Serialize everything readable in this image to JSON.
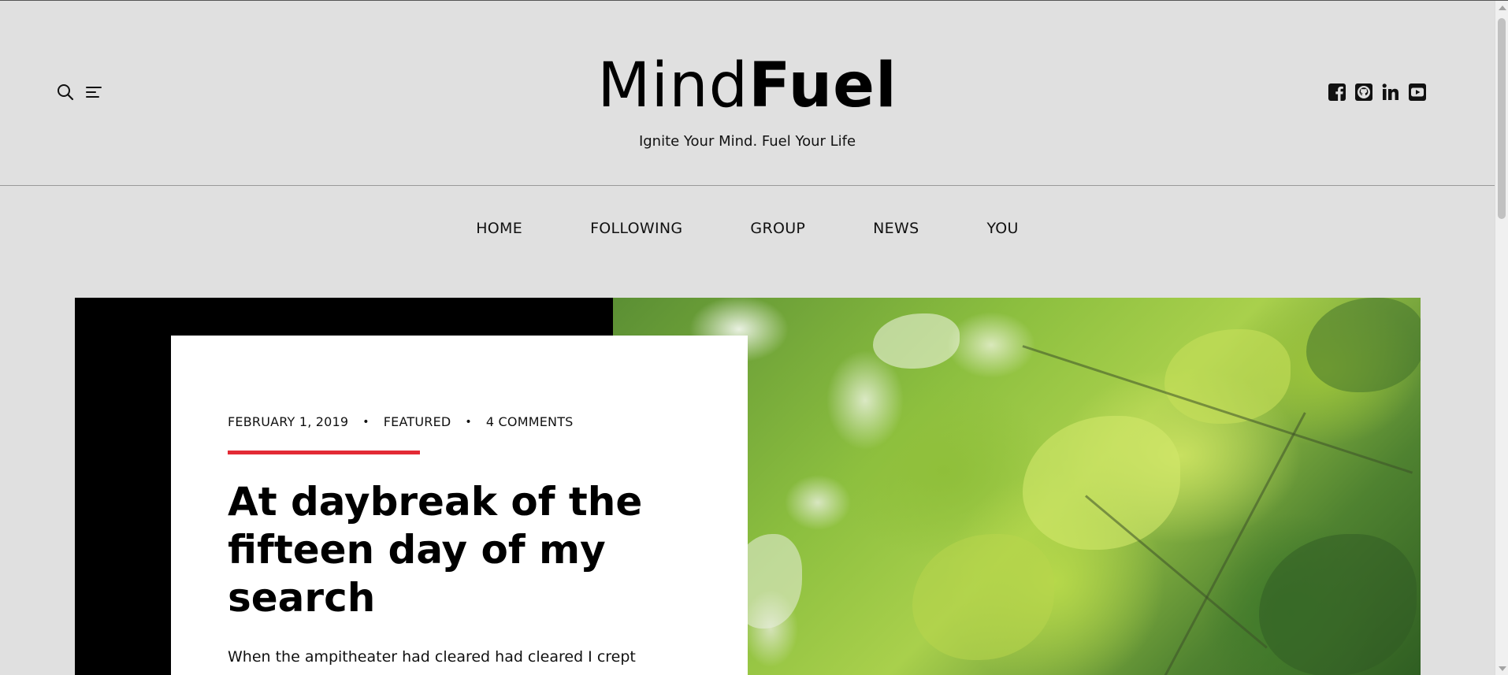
{
  "site": {
    "logo_light": "Mind",
    "logo_bold": "Fuel",
    "tagline": "Ignite Your Mind. Fuel Your Life"
  },
  "header_tools": [
    {
      "icon": "search-icon"
    },
    {
      "icon": "menu-icon"
    }
  ],
  "social": [
    {
      "icon": "facebook-icon"
    },
    {
      "icon": "github-icon"
    },
    {
      "icon": "linkedin-icon"
    },
    {
      "icon": "youtube-icon"
    }
  ],
  "nav": {
    "items": [
      "HOME",
      "FOLLOWING",
      "GROUP",
      "NEWS",
      "YOU"
    ]
  },
  "featured_post": {
    "date": "FEBRUARY 1, 2019",
    "category": "FEATURED",
    "comments": "4 COMMENTS",
    "separator": "•",
    "title": "At daybreak of the fifteen day of my search",
    "excerpt": "When the ampitheater had cleared had cleared I crept",
    "accent_color": "#e32a35"
  }
}
